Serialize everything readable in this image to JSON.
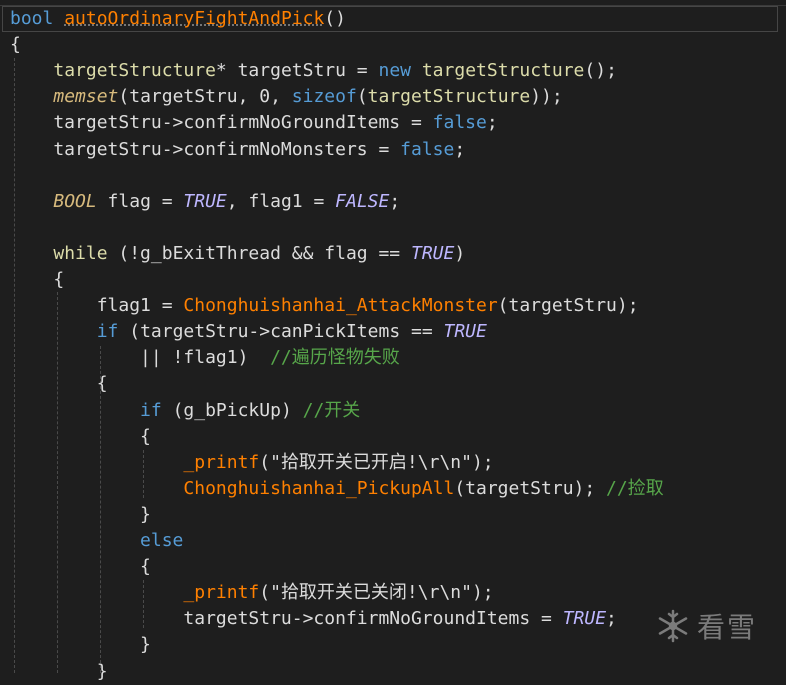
{
  "editor": {
    "lines": [
      [
        {
          "t": "bool",
          "c": "kw"
        },
        {
          "t": " "
        },
        {
          "t": "autoOrdinaryFightAndPick",
          "c": "fn squig"
        },
        {
          "t": "()"
        }
      ],
      [
        {
          "t": "{"
        }
      ],
      [
        {
          "t": "    "
        },
        {
          "t": "targetStructure",
          "c": "fd"
        },
        {
          "t": "* targetStru = "
        },
        {
          "t": "new",
          "c": "kw"
        },
        {
          "t": " "
        },
        {
          "t": "targetStructure",
          "c": "fd"
        },
        {
          "t": "();"
        }
      ],
      [
        {
          "t": "    "
        },
        {
          "t": "memset",
          "c": "tyi"
        },
        {
          "t": "(targetStru, 0, "
        },
        {
          "t": "sizeof",
          "c": "kw"
        },
        {
          "t": "("
        },
        {
          "t": "targetStructure",
          "c": "fd"
        },
        {
          "t": "));"
        }
      ],
      [
        {
          "t": "    targetStru->confirmNoGroundItems = "
        },
        {
          "t": "false",
          "c": "kw"
        },
        {
          "t": ";"
        }
      ],
      [
        {
          "t": "    targetStru->confirmNoMonsters = "
        },
        {
          "t": "false",
          "c": "kw"
        },
        {
          "t": ";"
        }
      ],
      [],
      [
        {
          "t": "    "
        },
        {
          "t": "BOOL",
          "c": "tyi"
        },
        {
          "t": " flag = "
        },
        {
          "t": "TRUE",
          "c": "mac"
        },
        {
          "t": ", flag1 = "
        },
        {
          "t": "FALSE",
          "c": "mac"
        },
        {
          "t": ";"
        }
      ],
      [],
      [
        {
          "t": "    "
        },
        {
          "t": "while",
          "c": "fd"
        },
        {
          "t": " (!g_bExitThread && flag == "
        },
        {
          "t": "TRUE",
          "c": "mac"
        },
        {
          "t": ")"
        }
      ],
      [
        {
          "t": "    {"
        }
      ],
      [
        {
          "t": "        flag1 = "
        },
        {
          "t": "Chonghuishanhai_AttackMonster",
          "c": "fn"
        },
        {
          "t": "(targetStru);"
        }
      ],
      [
        {
          "t": "        "
        },
        {
          "t": "if",
          "c": "kw"
        },
        {
          "t": " (targetStru->canPickItems == "
        },
        {
          "t": "TRUE",
          "c": "mac"
        }
      ],
      [
        {
          "t": "            || !flag1)  "
        },
        {
          "t": "//遍历怪物失败",
          "c": "cm"
        }
      ],
      [
        {
          "t": "        {"
        }
      ],
      [
        {
          "t": "            "
        },
        {
          "t": "if",
          "c": "kw"
        },
        {
          "t": " (g_bPickUp) "
        },
        {
          "t": "//开关",
          "c": "cm"
        }
      ],
      [
        {
          "t": "            {"
        }
      ],
      [
        {
          "t": "                "
        },
        {
          "t": "_printf",
          "c": "fn"
        },
        {
          "t": "(\""
        },
        {
          "t": "拾取开关已开启!\\r\\n",
          "c": "ph"
        },
        {
          "t": "\");"
        }
      ],
      [
        {
          "t": "                "
        },
        {
          "t": "Chonghuishanhai_PickupAll",
          "c": "fn"
        },
        {
          "t": "(targetStru); "
        },
        {
          "t": "//捡取",
          "c": "cm"
        }
      ],
      [
        {
          "t": "            }"
        }
      ],
      [
        {
          "t": "            "
        },
        {
          "t": "else",
          "c": "kw"
        }
      ],
      [
        {
          "t": "            {"
        }
      ],
      [
        {
          "t": "                "
        },
        {
          "t": "_printf",
          "c": "fn"
        },
        {
          "t": "(\""
        },
        {
          "t": "拾取开关已关闭!\\r\\n",
          "c": "ph"
        },
        {
          "t": "\");"
        }
      ],
      [
        {
          "t": "                targetStru->confirmNoGroundItems = "
        },
        {
          "t": "TRUE",
          "c": "mac"
        },
        {
          "t": ";"
        }
      ],
      [
        {
          "t": "            }"
        }
      ],
      [
        {
          "t": "        }"
        }
      ]
    ]
  },
  "watermark": {
    "text": "看雪",
    "icon": "snowflake-icon"
  }
}
